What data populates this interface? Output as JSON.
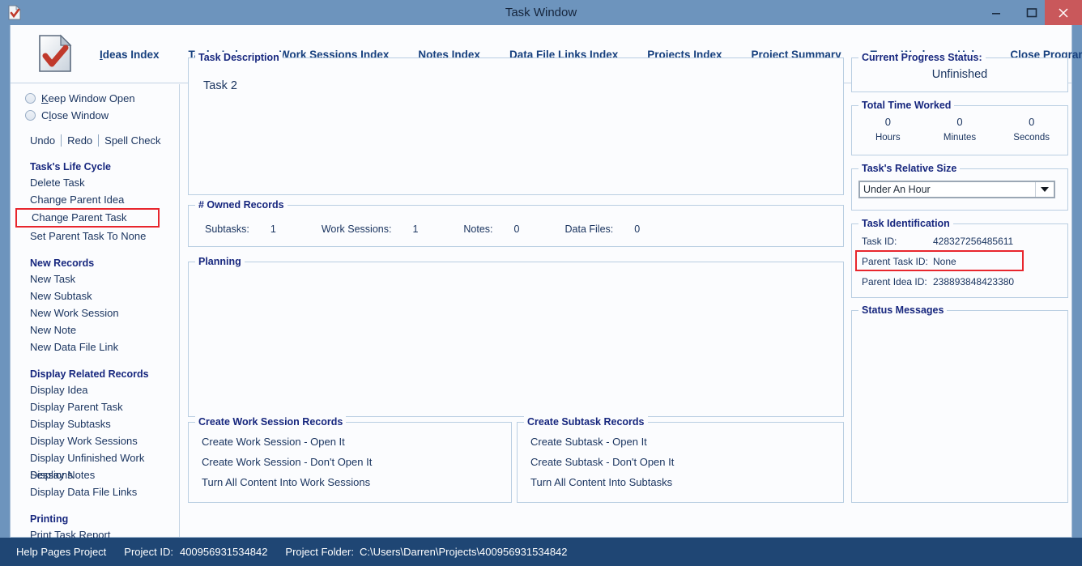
{
  "window": {
    "title": "Task Window",
    "icon": "document-check-icon",
    "minimize_label": "Minimize",
    "maximize_label": "Maximize",
    "close_label": "Close",
    "titlebar_color": "#6d94bd",
    "close_button_color": "#c9585b"
  },
  "menubar": {
    "logo": "document-check-logo",
    "items": [
      {
        "label": "Ideas Index",
        "accel_index": 0
      },
      {
        "label": "Tasks Index",
        "accel_index": 0
      },
      {
        "label": "Work Sessions Index",
        "accel_index": 0
      },
      {
        "label": "Notes Index",
        "accel_index": 0
      },
      {
        "label": "Data File Links Index",
        "accel_index": 0
      },
      {
        "label": "Projects Index",
        "accel_index": -1
      },
      {
        "label": "Project Summary",
        "accel_index": 0
      },
      {
        "label": "Team Work",
        "accel_index": 1
      },
      {
        "label": "Help",
        "accel_index": 0
      },
      {
        "label": "Close Program",
        "accel_index": 0
      }
    ]
  },
  "sidebar": {
    "radios": [
      {
        "label": "Keep Window Open",
        "accel_index": 0,
        "selected": false
      },
      {
        "label": "Close Window",
        "accel_index": 1,
        "selected": false
      }
    ],
    "edit_actions": [
      "Undo",
      "Redo",
      "Spell Check"
    ],
    "groups": [
      {
        "heading": "Task's Life Cycle",
        "links": [
          {
            "label": "Delete Task",
            "highlighted": false
          },
          {
            "label": "Change Parent Idea",
            "highlighted": false
          },
          {
            "label": "Change Parent Task",
            "highlighted": true
          },
          {
            "label": "Set Parent Task To None",
            "highlighted": false
          }
        ]
      },
      {
        "heading": "New Records",
        "links": [
          {
            "label": "New Task",
            "highlighted": false
          },
          {
            "label": "New Subtask",
            "highlighted": false
          },
          {
            "label": "New Work Session",
            "highlighted": false
          },
          {
            "label": "New Note",
            "highlighted": false
          },
          {
            "label": "New Data File Link",
            "highlighted": false
          }
        ]
      },
      {
        "heading": "Display Related Records",
        "links": [
          {
            "label": "Display Idea",
            "highlighted": false
          },
          {
            "label": "Display Parent Task",
            "highlighted": false
          },
          {
            "label": "Display Subtasks",
            "highlighted": false
          },
          {
            "label": "Display Work Sessions",
            "highlighted": false
          },
          {
            "label": "Display Unfinished Work Sessions",
            "highlighted": false
          },
          {
            "label": "Display Notes",
            "highlighted": false
          },
          {
            "label": "Display Data File Links",
            "highlighted": false
          }
        ]
      },
      {
        "heading": "Printing",
        "links": [
          {
            "label": "Print Task Report",
            "highlighted": false
          }
        ]
      }
    ]
  },
  "main": {
    "task_description": {
      "title": "Task Description",
      "value": "Task 2"
    },
    "owned_records": {
      "title": "# Owned Records",
      "counts": [
        {
          "label": "Subtasks:",
          "value": "1"
        },
        {
          "label": "Work Sessions:",
          "value": "1"
        },
        {
          "label": "Notes:",
          "value": "0"
        },
        {
          "label": "Data Files:",
          "value": "0"
        }
      ]
    },
    "planning": {
      "title": "Planning",
      "value": ""
    },
    "work_session_records": {
      "title": "Create Work Session Records",
      "links": [
        "Create Work Session - Open It",
        "Create Work Session - Don't Open It",
        "Turn All Content Into Work Sessions"
      ]
    },
    "subtask_records": {
      "title": "Create Subtask Records",
      "links": [
        "Create Subtask - Open It",
        "Create Subtask - Don't Open It",
        "Turn All Content Into Subtasks"
      ]
    }
  },
  "right": {
    "progress": {
      "title": "Current Progress Status:",
      "value": "Unfinished"
    },
    "time_worked": {
      "title": "Total Time Worked",
      "cells": [
        {
          "value": "0",
          "unit": "Hours"
        },
        {
          "value": "0",
          "unit": "Minutes"
        },
        {
          "value": "0",
          "unit": "Seconds"
        }
      ]
    },
    "relative_size": {
      "title": "Task's Relative Size",
      "selected": "Under An Hour"
    },
    "identification": {
      "title": "Task Identification",
      "rows": [
        {
          "label": "Task ID:",
          "value": "428327256485611",
          "highlighted": false
        },
        {
          "label": "Parent Task ID:",
          "value": "None",
          "highlighted": true
        },
        {
          "label": "Parent Idea ID:",
          "value": "238893848423380",
          "highlighted": false
        }
      ]
    },
    "status_messages": {
      "title": "Status Messages",
      "value": ""
    }
  },
  "statusbar": {
    "project_name": "Help Pages Project",
    "project_id_label": "Project ID:",
    "project_id": "400956931534842",
    "project_folder_label": "Project Folder:",
    "project_folder": "C:\\Users\\Darren\\Projects\\400956931534842"
  },
  "colors": {
    "accent": "#17407e",
    "highlight": "#e8262d",
    "statusbar_bg": "#1f4674"
  }
}
